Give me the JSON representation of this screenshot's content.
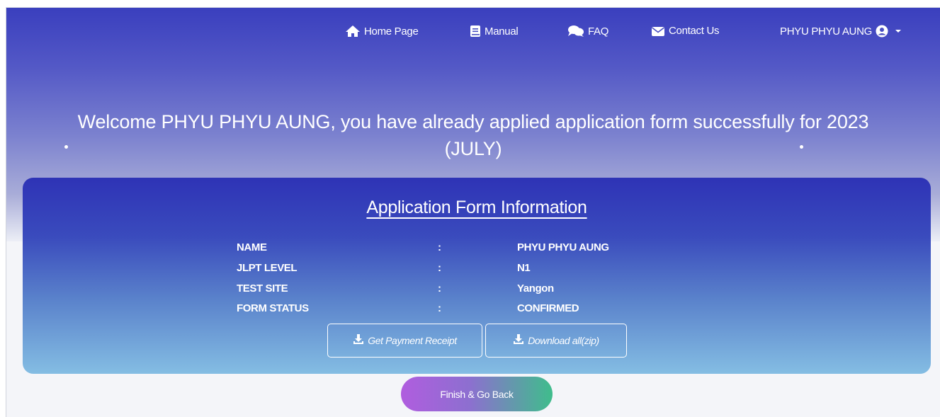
{
  "nav": {
    "home_label": "Home Page",
    "manual_label": "Manual",
    "faq_label": "FAQ",
    "contact_label": "Contact Us",
    "user_name": "PHYU PHYU AUNG"
  },
  "welcome": {
    "line1": "Welcome PHYU PHYU AUNG, you have already applied application form successfully for 2023",
    "line2": "(JULY)"
  },
  "card": {
    "title": "Application Form Information",
    "fields": [
      {
        "label": "NAME",
        "sep": ":",
        "value": "PHYU PHYU AUNG"
      },
      {
        "label": "JLPT LEVEL",
        "sep": ":",
        "value": "N1"
      },
      {
        "label": "TEST SITE",
        "sep": ":",
        "value": "Yangon"
      },
      {
        "label": "FORM STATUS",
        "sep": ":",
        "value": "CONFIRMED"
      }
    ],
    "receipt_button": "Get Payment Receipt",
    "download_button": "Download all(zip)"
  },
  "finish_button": "Finish & Go Back",
  "colors": {
    "brand_blue": "#3a3fbe",
    "card_top": "#2e33b6",
    "card_bottom": "#84bde3",
    "finish_start": "#b05ddf",
    "finish_end": "#3fbd8c"
  }
}
